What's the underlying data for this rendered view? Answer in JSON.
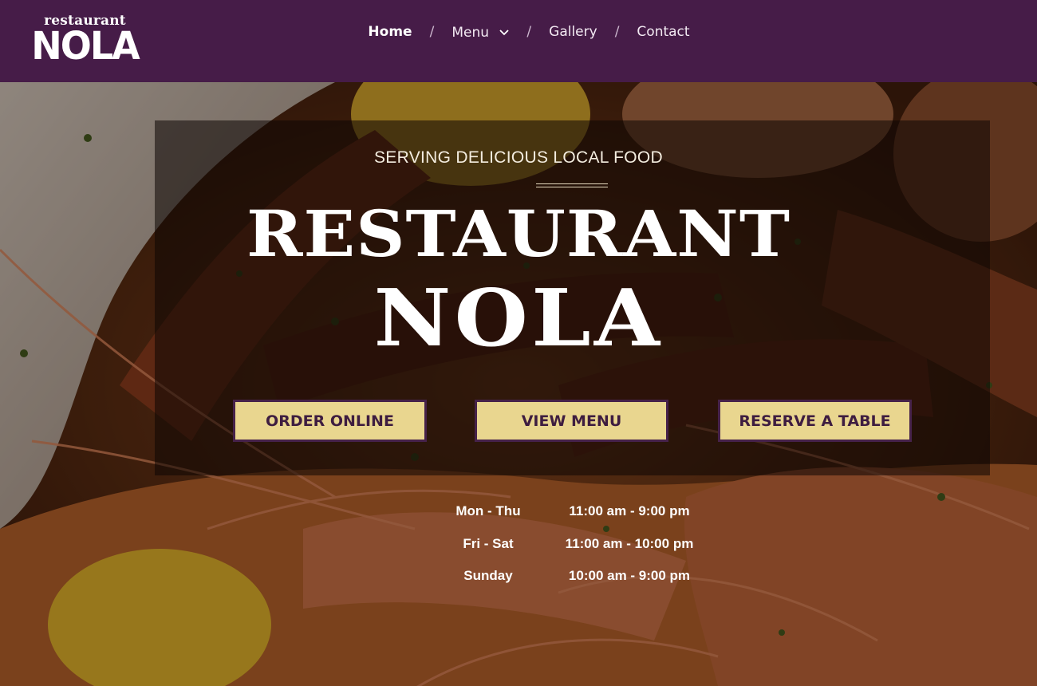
{
  "header": {
    "logo_small": "restaurant",
    "logo_big": "NOLA",
    "nav": [
      {
        "label": "Home",
        "active": true
      },
      {
        "label": "Menu",
        "active": false,
        "has_dropdown": true
      },
      {
        "label": "Gallery",
        "active": false
      },
      {
        "label": "Contact",
        "active": false
      }
    ],
    "separator": "/"
  },
  "hero": {
    "tagline": "SERVING DELICIOUS LOCAL FOOD",
    "title_line1": "RESTAURANT",
    "title_line2": "NOLA",
    "buttons": {
      "order": "ORDER ONLINE",
      "menu": "VIEW MENU",
      "reserve": "RESERVE A TABLE"
    }
  },
  "hours": [
    {
      "day": "Mon - Thu",
      "time": "11:00 am - 9:00 pm"
    },
    {
      "day": "Fri - Sat",
      "time": "11:00 am - 10:00 pm"
    },
    {
      "day": "Sunday",
      "time": "10:00 am - 9:00 pm"
    }
  ],
  "colors": {
    "header_bg": "#461c48",
    "button_bg": "#e9d68f",
    "button_border": "#46224a",
    "button_text": "#3e1d40"
  },
  "icons": {
    "menu_dropdown": "chevron-down-icon"
  }
}
